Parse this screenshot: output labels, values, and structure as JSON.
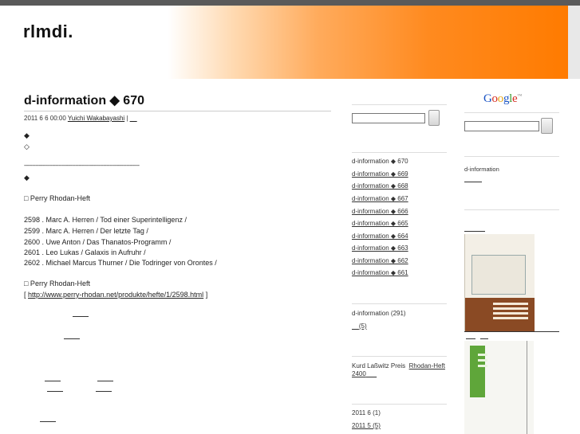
{
  "site": {
    "title": "rlmdi."
  },
  "post": {
    "title": "d-information ◆ 670",
    "date": "2011 6  6  00:00",
    "author": "Yuichi Wakabayashi",
    "separator": "|",
    "after_author": "__",
    "diamond_1": "◆",
    "diamond_2": "◇",
    "dashes": "----------------------------------------------------------------------",
    "diamond_3": "◆",
    "section_1": "□ Perry Rhodan-Heft",
    "list": [
      "2598 . Marc A. Herren / Tod einer Superintelligenz /",
      "2599 . Marc A. Herren / Der letzte Tag /",
      "2600 . Uwe Anton / Das Thanatos-Programm /",
      "2601 . Leo Lukas / Galaxis in Aufruhr /",
      "2602 . Michael Marcus Thurner / Die Todringer von Orontes /"
    ],
    "section_2": "□ Perry Rhodan-Heft",
    "link_open": "[",
    "link_url": "http://www.perry-rhodan.net/produkte/hefte/1/2598.html",
    "link_close": "]"
  },
  "mid_sidebar": {
    "recent": [
      {
        "label": "d-information ◆ 670",
        "underlined": false
      },
      {
        "label": "d-information ◆ 669",
        "underlined": true
      },
      {
        "label": "d-information ◆ 668",
        "underlined": true
      },
      {
        "label": "d-information ◆ 667",
        "underlined": true
      },
      {
        "label": "d-information ◆ 666",
        "underlined": true
      },
      {
        "label": "d-information ◆ 665",
        "underlined": true
      },
      {
        "label": "d-information ◆ 664",
        "underlined": true
      },
      {
        "label": "d-information ◆ 663",
        "underlined": true
      },
      {
        "label": "d-information ◆ 662",
        "underlined": true
      },
      {
        "label": "d-information ◆ 661",
        "underlined": true
      }
    ],
    "category": "d-information (291)",
    "category_2": "(5)",
    "tags": {
      "text": "Kurd Laßwitz Preis",
      "link1": "Rhodan-Heft",
      "line2": "2400"
    },
    "archive": [
      {
        "label": "2011 6  (1)",
        "underlined": false
      },
      {
        "label": "2011 5  (5)",
        "underlined": true
      }
    ]
  },
  "right_sidebar": {
    "google_letters": [
      "G",
      "o",
      "o",
      "g",
      "l",
      "e"
    ],
    "google_tm": "™",
    "google_colors": [
      "#1a53c4",
      "#d52a1f",
      "#e8a718",
      "#1a53c4",
      "#3a9a2f",
      "#d52a1f"
    ],
    "label": "d-information"
  }
}
